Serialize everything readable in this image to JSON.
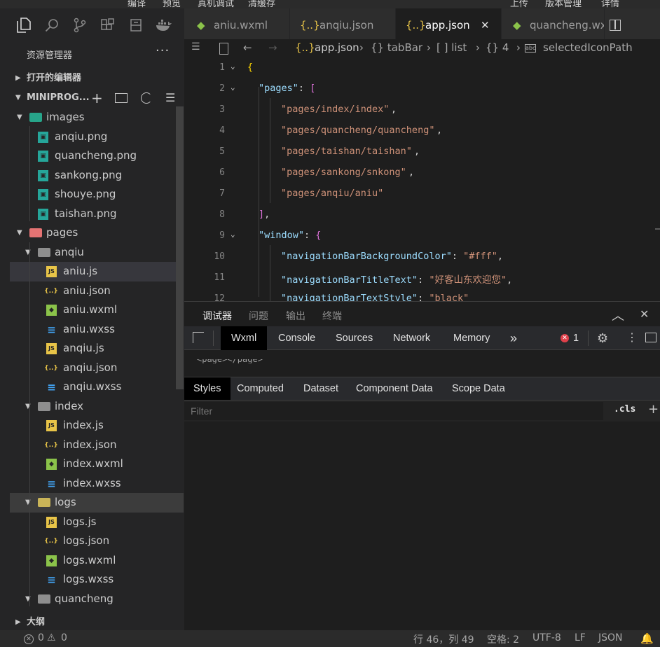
{
  "menu": [
    "编译",
    "预览",
    "真机调试",
    "清缓存",
    "上传",
    "版本管理",
    "详情"
  ],
  "activity_icons": [
    "files-icon",
    "search-icon",
    "source-control-icon",
    "extensions-icon",
    "database-icon",
    "docker-icon"
  ],
  "sidebar": {
    "title": "资源管理器",
    "more": "···",
    "open_editors": "打开的编辑器",
    "project": "MINIPROG...",
    "outline": "大纲",
    "tree": [
      {
        "label": "images",
        "type": "folder"
      },
      {
        "label": "anqiu.png",
        "type": "png"
      },
      {
        "label": "quancheng.png",
        "type": "png"
      },
      {
        "label": "sankong.png",
        "type": "png"
      },
      {
        "label": "shouye.png",
        "type": "png"
      },
      {
        "label": "taishan.png",
        "type": "png"
      },
      {
        "label": "pages",
        "type": "folder"
      },
      {
        "label": "anqiu",
        "type": "folder"
      },
      {
        "label": "aniu.js",
        "type": "js"
      },
      {
        "label": "aniu.json",
        "type": "json"
      },
      {
        "label": "aniu.wxml",
        "type": "wxml"
      },
      {
        "label": "aniu.wxss",
        "type": "wxss"
      },
      {
        "label": "anqiu.js",
        "type": "js"
      },
      {
        "label": "anqiu.json",
        "type": "json"
      },
      {
        "label": "anqiu.wxss",
        "type": "wxss"
      },
      {
        "label": "index",
        "type": "folder"
      },
      {
        "label": "index.js",
        "type": "js"
      },
      {
        "label": "index.json",
        "type": "json"
      },
      {
        "label": "index.wxml",
        "type": "wxml"
      },
      {
        "label": "index.wxss",
        "type": "wxss"
      },
      {
        "label": "logs",
        "type": "folder"
      },
      {
        "label": "logs.js",
        "type": "js"
      },
      {
        "label": "logs.json",
        "type": "json"
      },
      {
        "label": "logs.wxml",
        "type": "wxml"
      },
      {
        "label": "logs.wxss",
        "type": "wxss"
      },
      {
        "label": "quancheng",
        "type": "folder"
      }
    ]
  },
  "icon_glyphs": {
    "js": "JS",
    "json": "{..}",
    "wxss": "≡",
    "wxml": "◆",
    "png": "▣"
  },
  "tabs": [
    {
      "label": "aniu.wxml",
      "icon": "wxml"
    },
    {
      "label": "anqiu.json",
      "icon": "json"
    },
    {
      "label": "app.json",
      "icon": "json"
    },
    {
      "label": "quancheng.wx",
      "icon": "wxml"
    }
  ],
  "tab_close": "✕",
  "breadcrumb": {
    "file": "app.json",
    "items": [
      "{} tabBar",
      "[ ] list",
      "{} 4",
      "selectedIconPath"
    ]
  },
  "code": {
    "line_numbers": [
      "1",
      "2",
      "3",
      "4",
      "5",
      "6",
      "7",
      "8",
      "9",
      "10",
      "11",
      "12"
    ],
    "pages_key": "\"pages\"",
    "pages": [
      "\"pages/index/index\"",
      "\"pages/quancheng/quancheng\"",
      "\"pages/taishan/taishan\"",
      "\"pages/sankong/snkong\"",
      "\"pages/anqiu/aniu\""
    ],
    "window_key": "\"window\"",
    "nav_bg_key": "\"navigationBarBackgroundColor\"",
    "nav_bg_val": "\"#fff\"",
    "nav_title_key": "\"navigationBarTitleText\"",
    "nav_title_val": "\"好客山东欢迎您\"",
    "nav_style_key": "\"navigationBarTextStyle\"",
    "nav_style_val": "\"black\""
  },
  "panel": {
    "tabs": [
      "调试器",
      "问题",
      "输出",
      "终端"
    ],
    "devtools_tabs": [
      "Wxml",
      "Console",
      "Sources",
      "Network",
      "Memory"
    ],
    "more": "»",
    "error_count": "1",
    "page_tag": "<page></page>",
    "style_tabs": [
      "Styles",
      "Computed",
      "Dataset",
      "Component Data",
      "Scope Data"
    ],
    "filter_placeholder": "Filter",
    "cls": ".cls",
    "plus": "+"
  },
  "status": {
    "errors": "0",
    "warnings": "0",
    "position": "行 46，列 49",
    "spaces": "空格: 2",
    "encoding": "UTF-8",
    "eol": "LF",
    "language": "JSON"
  },
  "colors": {
    "folder_images": "#27a58a",
    "folder_pages": "#e57373",
    "js": "#e8c448",
    "json": "#e8c448",
    "wxml": "#8bc34a",
    "wxss": "#42a5f5",
    "png": "#26a69a"
  }
}
